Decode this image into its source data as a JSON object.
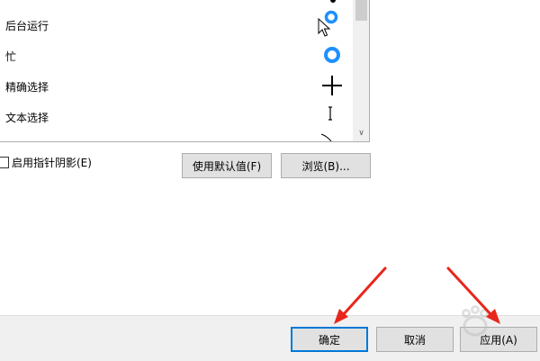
{
  "cursor_list": {
    "items": [
      {
        "label": "后台运行",
        "icon": "working-in-background-cursor-icon"
      },
      {
        "label": "忙",
        "icon": "busy-cursor-icon"
      },
      {
        "label": "精确选择",
        "icon": "precision-select-cursor-icon"
      },
      {
        "label": "文本选择",
        "icon": "text-select-cursor-icon"
      }
    ]
  },
  "shadow_option": {
    "label": "启用指针阴影(E)",
    "checked": false
  },
  "buttons": {
    "use_default": "使用默认值(F)",
    "browse": "浏览(B)..."
  },
  "footer": {
    "ok": "确定",
    "cancel": "取消",
    "apply": "应用(A)"
  },
  "colors": {
    "accent": "#0078d7",
    "busy_ring": "#1e90ff",
    "arrow": "#e8261c"
  }
}
